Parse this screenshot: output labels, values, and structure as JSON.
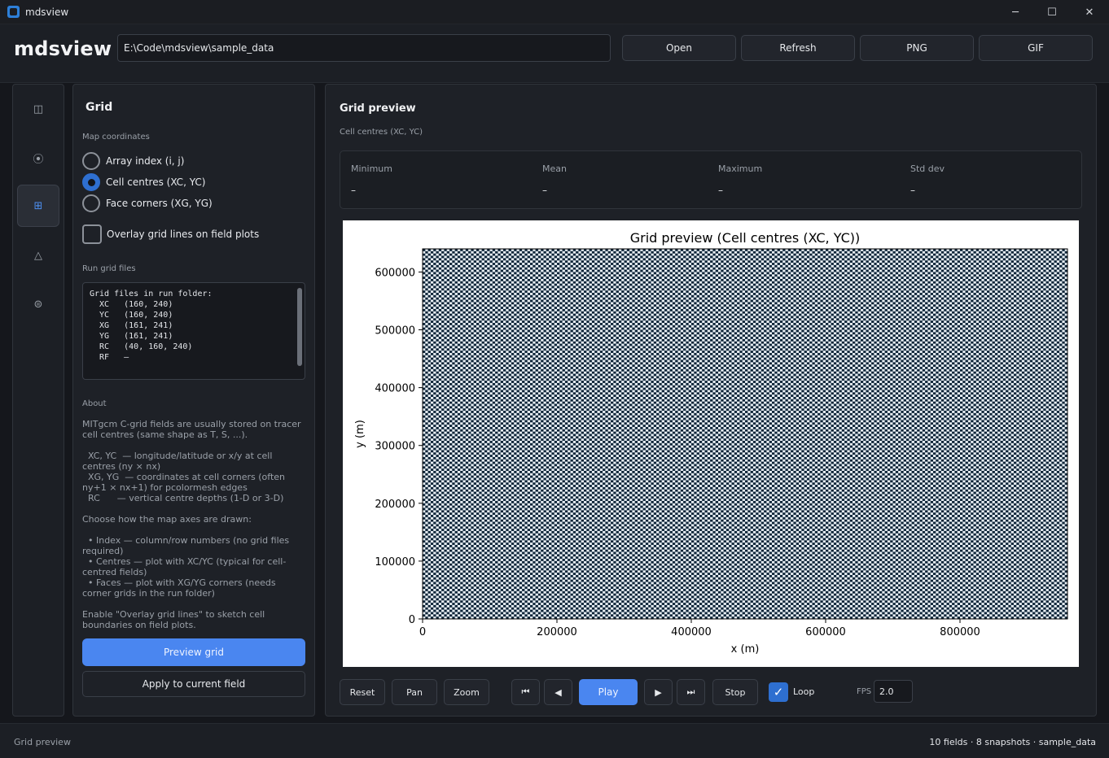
{
  "window": {
    "title": "mdsview",
    "minimize": "─",
    "maximize": "☐",
    "close": "✕"
  },
  "header": {
    "brand": "mdsview",
    "path_value": "E:\\Code\\mdsview\\sample_data",
    "buttons": {
      "open": "Open",
      "refresh": "Refresh",
      "png": "PNG",
      "gif": "GIF"
    }
  },
  "rail": {
    "items": [
      {
        "icon": "panel-icon",
        "glyph": "◫",
        "active": false
      },
      {
        "icon": "target-icon",
        "glyph": "⦿",
        "active": false
      },
      {
        "icon": "grid-icon",
        "glyph": "⊞",
        "active": true
      },
      {
        "icon": "triangle-icon",
        "glyph": "△",
        "active": false
      },
      {
        "icon": "layers-icon",
        "glyph": "⊜",
        "active": false
      }
    ]
  },
  "left": {
    "title": "Grid",
    "map_coords_label": "Map coordinates",
    "options": [
      {
        "label": "Array index (i, j)",
        "selected": false
      },
      {
        "label": "Cell centres (XC, YC)",
        "selected": true
      },
      {
        "label": "Face corners (XG, YG)",
        "selected": false
      }
    ],
    "overlay_label": "Overlay grid lines on field plots",
    "overlay_checked": false,
    "run_grid_label": "Run grid files",
    "grid_files_text": "Grid files in run folder:\n  XC   (160, 240)\n  YC   (160, 240)\n  XG   (161, 241)\n  YG   (161, 241)\n  RC   (40, 160, 240)\n  RF   —",
    "about_label": "About",
    "about_paragraphs": [
      "MITgcm C-grid fields are usually stored on tracer cell centres (same shape as T, S, ...).",
      "  XC, YC  — longitude/latitude or x/y at cell centres (ny × nx)\n  XG, YG  — coordinates at cell corners (often ny+1 × nx+1) for pcolormesh edges\n  RC      — vertical centre depths (1-D or 3-D)",
      "Choose how the map axes are drawn:",
      "  • Index — column/row numbers (no grid files required)\n  • Centres — plot with XC/YC (typical for cell-centred fields)\n  • Faces — plot with XG/YG corners (needs corner grids in the run folder)",
      "Enable \"Overlay grid lines\" to sketch cell boundaries on field plots."
    ],
    "preview_button": "Preview grid",
    "apply_button": "Apply to current field"
  },
  "main": {
    "title": "Grid preview",
    "subtitle": "Cell centres (XC, YC)",
    "stats": [
      {
        "label": "Minimum",
        "value": "–"
      },
      {
        "label": "Mean",
        "value": "–"
      },
      {
        "label": "Maximum",
        "value": "–"
      },
      {
        "label": "Std dev",
        "value": "–"
      }
    ],
    "controls": {
      "reset": "Reset",
      "pan": "Pan",
      "zoom": "Zoom",
      "first": "⏮",
      "prev": "◀",
      "play": "Play",
      "next": "▶",
      "last": "⏭",
      "stop": "Stop",
      "loop": "Loop",
      "loop_checked": true,
      "fps_label": "FPS",
      "fps_value": "2.0"
    }
  },
  "chart_data": {
    "type": "heatmap",
    "title": "Grid preview (Cell centres (XC, YC))",
    "xlabel": "x (m)",
    "ylabel": "y (m)",
    "xlim": [
      0,
      960000
    ],
    "ylim": [
      0,
      640000
    ],
    "xticks": [
      0,
      200000,
      400000,
      600000,
      800000
    ],
    "yticks": [
      0,
      100000,
      200000,
      300000,
      400000,
      500000,
      600000
    ],
    "xtick_labels": [
      "0",
      "200000",
      "400000",
      "600000",
      "800000"
    ],
    "ytick_labels": [
      "0",
      "100000",
      "200000",
      "300000",
      "400000",
      "500000",
      "600000"
    ],
    "nx": 240,
    "ny": 160,
    "pattern": "checkerboard",
    "colors": [
      "#0d2438",
      "#e8eef3"
    ]
  },
  "statusbar": {
    "left": "Grid preview",
    "right": "10 fields · 8 snapshots · sample_data"
  }
}
